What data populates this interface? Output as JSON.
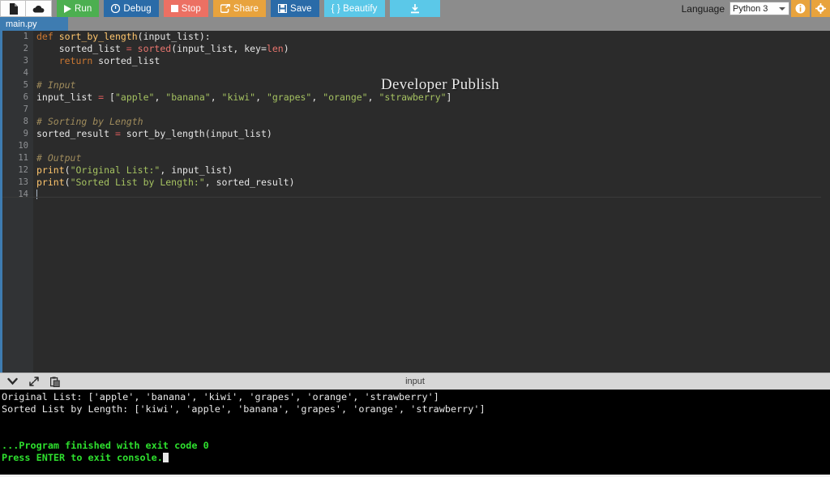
{
  "toolbar": {
    "new_file_icon": "file-icon",
    "upload_icon": "cloud-upload-icon",
    "run_label": "Run",
    "debug_label": "Debug",
    "stop_label": "Stop",
    "share_label": "Share",
    "save_label": "Save",
    "beautify_label": "{ } Beautify",
    "download_icon": "download-icon",
    "language_label": "Language",
    "language_value": "Python 3",
    "info_icon": "info-icon",
    "settings_icon": "gear-icon",
    "colors": {
      "run": "#4caf50",
      "debug": "#2a6ba8",
      "stop": "#ec7063",
      "share": "#e8a33d",
      "save": "#2a6ba8",
      "beautify": "#5bc8e8",
      "download": "#5bc8e8",
      "orange_icon": "#e8a33d",
      "toolbar_bg": "#8c8c8c"
    }
  },
  "tabs": [
    {
      "label": "main.py",
      "active": true
    }
  ],
  "editor": {
    "watermark": "Developer Publish",
    "line_numbers": [
      "1",
      "2",
      "3",
      "4",
      "5",
      "6",
      "7",
      "8",
      "9",
      "10",
      "11",
      "12",
      "13",
      "14"
    ],
    "background": "#2b2b2b",
    "gutter_background": "#313335",
    "accent": "#3e7cb1",
    "lines": [
      {
        "n": 1,
        "text": "def sort_by_length(input_list):"
      },
      {
        "n": 2,
        "text": "    sorted_list = sorted(input_list, key=len)"
      },
      {
        "n": 3,
        "text": "    return sorted_list"
      },
      {
        "n": 4,
        "text": ""
      },
      {
        "n": 5,
        "text": "# Input"
      },
      {
        "n": 6,
        "text": "input_list = [\"apple\", \"banana\", \"kiwi\", \"grapes\", \"orange\", \"strawberry\"]"
      },
      {
        "n": 7,
        "text": ""
      },
      {
        "n": 8,
        "text": "# Sorting by Length"
      },
      {
        "n": 9,
        "text": "sorted_result = sort_by_length(input_list)"
      },
      {
        "n": 10,
        "text": ""
      },
      {
        "n": 11,
        "text": "# Output"
      },
      {
        "n": 12,
        "text": "print(\"Original List:\", input_list)"
      },
      {
        "n": 13,
        "text": "print(\"Sorted List by Length:\", sorted_result)"
      },
      {
        "n": 14,
        "text": ""
      }
    ],
    "tokens": {
      "l1": {
        "kw": "def",
        "fn": "sort_by_length",
        "args": "(input_list):"
      },
      "l2": {
        "indent": "    ",
        "name": "sorted_list ",
        "eq": "=",
        "builtin": " sorted",
        "rest": "(input_list, key=",
        "len": "len",
        "close": ")"
      },
      "l3": {
        "indent": "    ",
        "kw": "return",
        "name": " sorted_list"
      },
      "l5": {
        "comment": "# Input"
      },
      "l6": {
        "name": "input_list ",
        "eq": "=",
        "open": " [",
        "s1": "\"apple\"",
        "c1": ", ",
        "s2": "\"banana\"",
        "c2": ", ",
        "s3": "\"kiwi\"",
        "c3": ", ",
        "s4": "\"grapes\"",
        "c4": ", ",
        "s5": "\"orange\"",
        "c5": ", ",
        "s6": "\"strawberry\"",
        "close": "]"
      },
      "l8": {
        "comment": "# Sorting by Length"
      },
      "l9": {
        "name": "sorted_result ",
        "eq": "=",
        "call": " sort_by_length(input_list)"
      },
      "l11": {
        "comment": "# Output"
      },
      "l12": {
        "fn": "print",
        "open": "(",
        "str": "\"Original List:\"",
        "rest": ", input_list)"
      },
      "l13": {
        "fn": "print",
        "open": "(",
        "str": "\"Sorted List by Length:\"",
        "rest": ", sorted_result)"
      }
    }
  },
  "console_header": {
    "collapse_icon": "chevron-down-icon",
    "expand_icon": "expand-arrows-icon",
    "paste_icon": "clipboard-paste-icon",
    "title": "input"
  },
  "console": {
    "background": "#000000",
    "success_color": "#2ee02e",
    "lines": [
      {
        "text": "Original List: ['apple', 'banana', 'kiwi', 'grapes', 'orange', 'strawberry']",
        "style": "normal"
      },
      {
        "text": "Sorted List by Length: ['kiwi', 'apple', 'banana', 'grapes', 'orange', 'strawberry']",
        "style": "normal"
      },
      {
        "text": "",
        "style": "blank"
      },
      {
        "text": "",
        "style": "blank"
      },
      {
        "text": "...Program finished with exit code 0",
        "style": "ok"
      },
      {
        "text": "Press ENTER to exit console.",
        "style": "ok"
      }
    ]
  }
}
